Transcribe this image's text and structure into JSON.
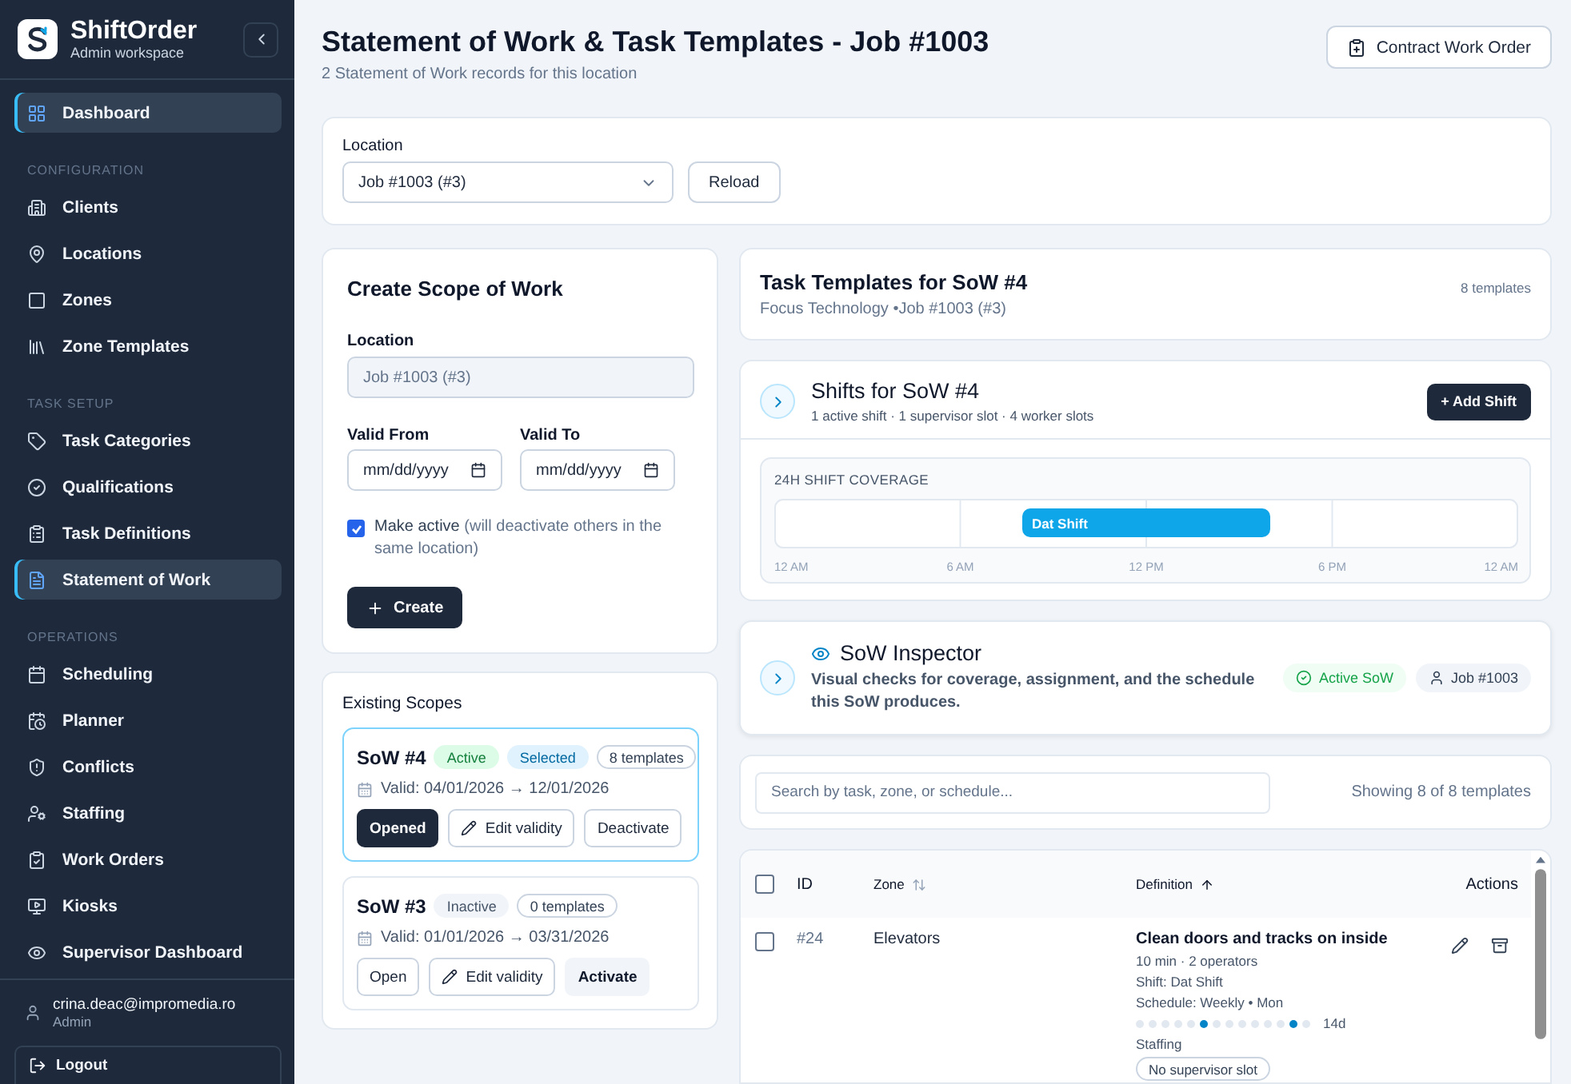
{
  "brand": {
    "name": "ShiftOrder",
    "subtitle": "Admin workspace"
  },
  "sidebar": {
    "sections": [
      {
        "items": [
          {
            "label": "Dashboard",
            "selected": true
          }
        ]
      },
      {
        "heading": "CONFIGURATION",
        "items": [
          {
            "label": "Clients",
            "selected": false
          },
          {
            "label": "Locations",
            "selected": false
          },
          {
            "label": "Zones",
            "selected": false
          },
          {
            "label": "Zone Templates",
            "selected": false
          }
        ]
      },
      {
        "heading": "TASK SETUP",
        "items": [
          {
            "label": "Task Categories",
            "selected": false
          },
          {
            "label": "Qualifications",
            "selected": false
          },
          {
            "label": "Task Definitions",
            "selected": false
          },
          {
            "label": "Statement of Work",
            "selected": true
          }
        ]
      },
      {
        "heading": "OPERATIONS",
        "items": [
          {
            "label": "Scheduling",
            "selected": false
          },
          {
            "label": "Planner",
            "selected": false
          },
          {
            "label": "Conflicts",
            "selected": false
          },
          {
            "label": "Staffing",
            "selected": false
          },
          {
            "label": "Work Orders",
            "selected": false
          },
          {
            "label": "Kiosks",
            "selected": false
          },
          {
            "label": "Supervisor Dashboard",
            "selected": false
          }
        ]
      }
    ],
    "user": {
      "email": "crina.deac@impromedia.ro",
      "role": "Admin"
    },
    "logout": "Logout"
  },
  "header": {
    "title": "Statement of Work & Task Templates - Job #1003",
    "subtitle": "2 Statement of Work records for this location",
    "action": "Contract Work Order"
  },
  "location_bar": {
    "label": "Location",
    "value": "Job #1003 (#3)",
    "reload": "Reload"
  },
  "create_form": {
    "title": "Create Scope of Work",
    "location_label": "Location",
    "location_value": "Job #1003 (#3)",
    "valid_from_label": "Valid From",
    "valid_from_placeholder": "mm/dd/yyyy",
    "valid_to_label": "Valid To",
    "valid_to_placeholder": "mm/dd/yyyy",
    "make_active": {
      "label": "Make active",
      "hint": "(will deactivate others in the same location)",
      "checked": true
    },
    "submit": "Create"
  },
  "existing_scopes": {
    "title": "Existing Scopes",
    "items": [
      {
        "title": "SoW #4",
        "selected": true,
        "badges": [
          {
            "label": "Active",
            "kind": "active"
          },
          {
            "label": "Selected",
            "kind": "selected"
          },
          {
            "label": "8 templates",
            "kind": "count"
          }
        ],
        "validity": "Valid: 04/01/2026 → 12/01/2026",
        "actions": [
          {
            "label": "Opened",
            "kind": "primary"
          },
          {
            "label": "Edit validity",
            "kind": "edit"
          },
          {
            "label": "Deactivate",
            "kind": "outline"
          }
        ]
      },
      {
        "title": "SoW #3",
        "selected": false,
        "badges": [
          {
            "label": "Inactive",
            "kind": "inactive"
          },
          {
            "label": "0 templates",
            "kind": "count"
          }
        ],
        "validity": "Valid: 01/01/2026 → 03/31/2026",
        "actions": [
          {
            "label": "Open",
            "kind": "outline"
          },
          {
            "label": "Edit validity",
            "kind": "edit"
          },
          {
            "label": "Activate",
            "kind": "soft"
          }
        ]
      }
    ]
  },
  "templates_header": {
    "title": "Task Templates for SoW #4",
    "subtitle": "Focus Technology •Job #1003 (#3)",
    "count": "8 templates"
  },
  "shifts": {
    "title": "Shifts for SoW #4",
    "summary": "1 active shift · 1 supervisor slot · 4 worker slots",
    "add": "+ Add Shift",
    "expanded": false,
    "coverage_title": "24H SHIFT COVERAGE",
    "coverage": {
      "ticks": [
        "12 AM",
        "6 AM",
        "12 PM",
        "6 PM",
        "12 AM"
      ],
      "shifts": [
        {
          "label": "Dat Shift"
        }
      ]
    }
  },
  "inspector": {
    "title": "SoW Inspector",
    "description": "Visual checks for coverage, assignment, and the schedule this SoW produces.",
    "expanded": false,
    "badges": [
      {
        "label": "Active SoW",
        "kind": "status"
      },
      {
        "label": "Job #1003",
        "kind": "job"
      }
    ]
  },
  "search": {
    "placeholder": "Search by task, zone, or schedule...",
    "count": "Showing 8 of 8 templates"
  },
  "table": {
    "columns": [
      {
        "label": "ID",
        "kind": "plain"
      },
      {
        "label": "Zone",
        "kind": "sortable"
      },
      {
        "label": "Definition",
        "kind": "sorted"
      },
      {
        "label": "Actions",
        "kind": "actions"
      }
    ],
    "all_checked": false,
    "rows": [
      {
        "checked": false,
        "id": "#24",
        "zone": "Elevators",
        "title": "Clean doors and tracks on inside",
        "details": [
          "10 min · 2 operators",
          "Shift: Dat Shift",
          "Schedule: Weekly • Mon"
        ],
        "days": [
          {
            "on": false
          },
          {
            "on": false
          },
          {
            "on": false
          },
          {
            "on": false
          },
          {
            "on": false
          },
          {
            "on": true
          },
          {
            "on": false
          },
          {
            "on": false
          },
          {
            "on": false
          },
          {
            "on": false
          },
          {
            "on": false
          },
          {
            "on": false
          },
          {
            "on": true
          },
          {
            "on": false
          }
        ],
        "span": "14d",
        "staffing_label": "Staffing",
        "staffing": [
          "No supervisor slot"
        ]
      }
    ]
  }
}
